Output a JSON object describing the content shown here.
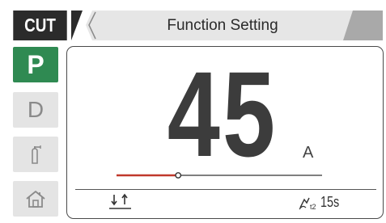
{
  "header": {
    "mode_tag": "CUT",
    "title": "Function Setting"
  },
  "sidebar": {
    "items": [
      {
        "label": "P",
        "active": true
      },
      {
        "label": "D",
        "active": false
      },
      {
        "icon": "gas-cylinder-icon",
        "active": false
      },
      {
        "icon": "home-icon",
        "active": false
      }
    ]
  },
  "main": {
    "value": "45",
    "unit": "A",
    "slider_fraction": 0.3
  },
  "footer": {
    "gas_icon": "gas-flow-icon",
    "timer_icon": "post-flow-icon",
    "timer_value": "15s",
    "timer_sub": "t2"
  },
  "colors": {
    "header_dark": "#2b2b2b",
    "header_bg": "#e6e6e6",
    "active_green": "#2f8a52",
    "inactive_bg": "#e4e4e4",
    "slider_fill": "#c0392b",
    "slider_track": "#555555"
  }
}
